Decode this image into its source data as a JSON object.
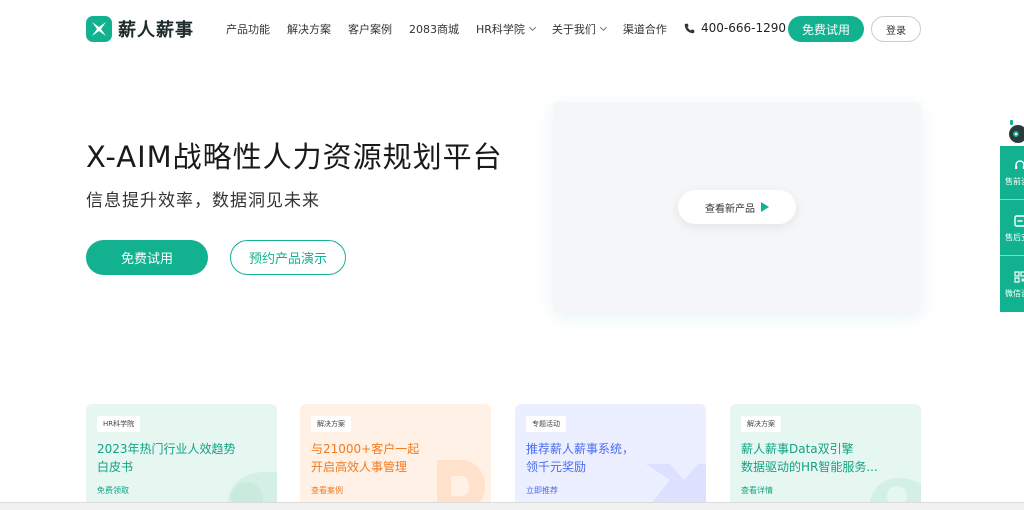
{
  "brand": {
    "name": "薪人薪事"
  },
  "nav": {
    "items": [
      {
        "label": "产品功能",
        "has_caret": false
      },
      {
        "label": "解决方案",
        "has_caret": false
      },
      {
        "label": "客户案例",
        "has_caret": false
      },
      {
        "label": "2083商城",
        "has_caret": false
      },
      {
        "label": "HR科学院",
        "has_caret": true
      },
      {
        "label": "关于我们",
        "has_caret": true
      },
      {
        "label": "渠道合作",
        "has_caret": false
      }
    ]
  },
  "header": {
    "phone": "400-666-1290",
    "trial_label": "免费试用",
    "login_label": "登录"
  },
  "hero": {
    "title": "X-AIM战略性人力资源规划平台",
    "subtitle": "信息提升效率，数据洞见未来",
    "trial_label": "免费试用",
    "demo_label": "预约产品演示",
    "video_label": "查看新产品"
  },
  "side_widget": {
    "items": [
      {
        "label": "售前咨询",
        "icon": "headset-icon"
      },
      {
        "label": "售后支持",
        "icon": "message-icon"
      },
      {
        "label": "微信咨询",
        "icon": "qrcode-icon"
      }
    ]
  },
  "cards": [
    {
      "tag": "HR科学院",
      "title_line1": "2023年热门行业人效趋势",
      "title_line2": "白皮书",
      "link": "免费领取"
    },
    {
      "tag": "解决方案",
      "title_line1": "与21000+客户一起",
      "title_line2": "开启高效人事管理",
      "link": "查看案例"
    },
    {
      "tag": "专题活动",
      "title_line1": "推荐薪人薪事系统，",
      "title_line2": "领千元奖励",
      "link": "立即推荐"
    },
    {
      "tag": "解决方案",
      "title_line1": "薪人薪事Data双引擎",
      "title_line2": "数据驱动的HR智能服务...",
      "link": "查看详情"
    }
  ],
  "colors": {
    "brand_green": "#12b291",
    "orange": "#f07a22",
    "blue": "#4a6cf0"
  }
}
